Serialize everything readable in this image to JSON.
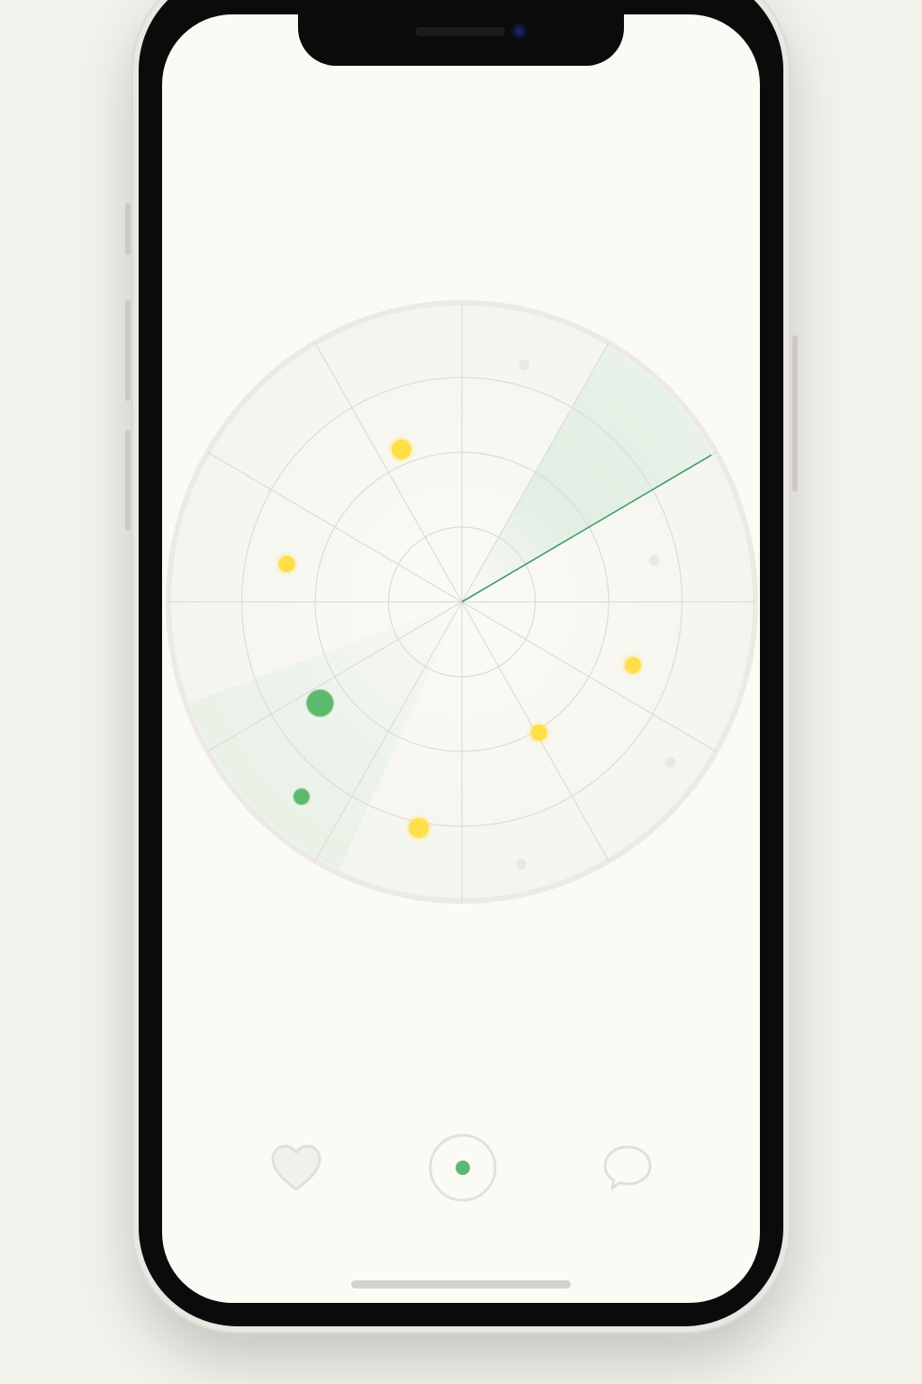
{
  "colors": {
    "background": "#f3f1ec",
    "screen": "#fcfaf4",
    "grid": "#dcdcd6",
    "sweep": "#3f9a6a",
    "blip_yellow": "#ffdf4a",
    "blip_green": "#5cb96e",
    "blip_faint": "#e9e8e3",
    "nav_icon": "#e2e1dd",
    "nav_active_dot": "#5cb96e"
  },
  "radar": {
    "rings": 4,
    "spokes": 12,
    "sweep_angle_deg": 30,
    "blips": [
      {
        "id": "blip-1",
        "color": "yellow",
        "angle_deg": 112,
        "range": 0.55,
        "size": "medium"
      },
      {
        "id": "blip-2",
        "color": "yellow",
        "angle_deg": 168,
        "range": 0.61,
        "size": "small"
      },
      {
        "id": "blip-3",
        "color": "green",
        "angle_deg": 215,
        "range": 0.59,
        "size": "large"
      },
      {
        "id": "blip-4",
        "color": "green",
        "angle_deg": 230,
        "range": 0.85,
        "size": "small"
      },
      {
        "id": "blip-5",
        "color": "yellow",
        "angle_deg": 259,
        "range": 0.77,
        "size": "medium"
      },
      {
        "id": "blip-6",
        "color": "yellow",
        "angle_deg": 301,
        "range": 0.51,
        "size": "small"
      },
      {
        "id": "blip-7",
        "color": "yellow",
        "angle_deg": 340,
        "range": 0.62,
        "size": "small"
      },
      {
        "id": "blip-8",
        "color": "faint",
        "angle_deg": 75,
        "range": 0.82,
        "size": "tiny"
      },
      {
        "id": "blip-9",
        "color": "faint",
        "angle_deg": 12,
        "range": 0.67,
        "size": "tiny"
      },
      {
        "id": "blip-10",
        "color": "faint",
        "angle_deg": 323,
        "range": 0.89,
        "size": "tiny"
      },
      {
        "id": "blip-11",
        "color": "faint",
        "angle_deg": 283,
        "range": 0.9,
        "size": "tiny"
      }
    ]
  },
  "nav": {
    "items": [
      {
        "name": "favorites",
        "icon": "heart-icon",
        "active": false
      },
      {
        "name": "radar",
        "icon": "radar-dot-icon",
        "active": true
      },
      {
        "name": "messages",
        "icon": "chat-bubble-icon",
        "active": false
      }
    ]
  }
}
